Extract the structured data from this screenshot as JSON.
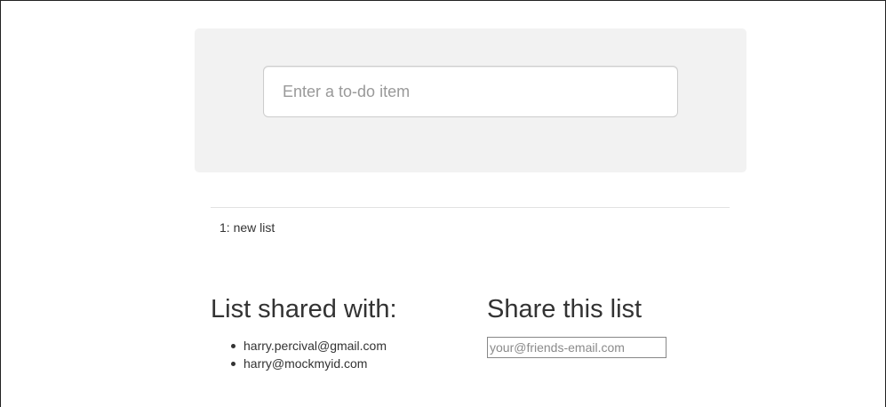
{
  "todo_form": {
    "placeholder": "Enter a to-do item",
    "value": ""
  },
  "list": {
    "items": [
      "1: new list"
    ]
  },
  "shared_with": {
    "heading": "List shared with:",
    "emails": [
      "harry.percival@gmail.com",
      "harry@mockmyid.com"
    ]
  },
  "share_form": {
    "heading": "Share this list",
    "placeholder": "your@friends-email.com",
    "value": ""
  }
}
